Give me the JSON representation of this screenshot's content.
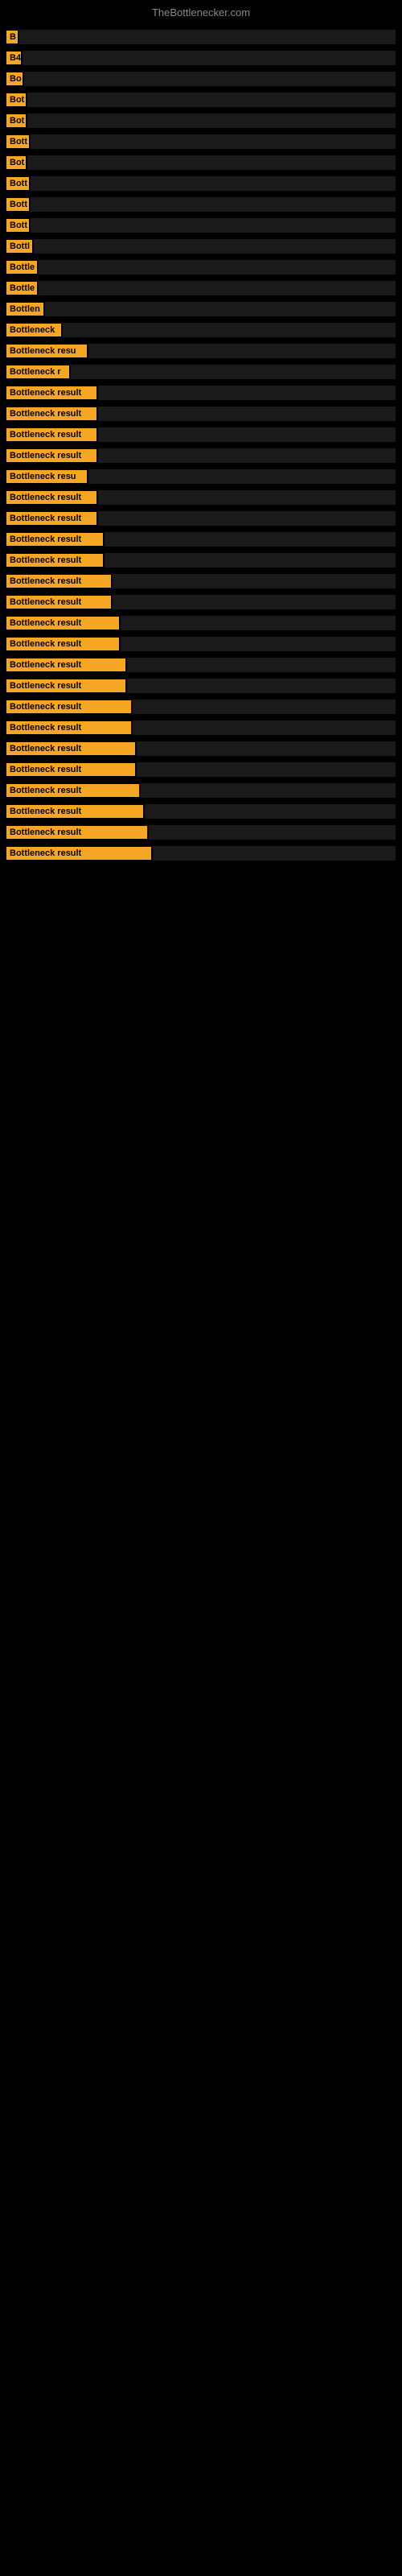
{
  "site": {
    "title": "TheBottlenecker.com"
  },
  "items": [
    {
      "label": "B",
      "labelWidth": 14,
      "barWidth": 380
    },
    {
      "label": "B4",
      "labelWidth": 18,
      "barWidth": 370
    },
    {
      "label": "Bo",
      "labelWidth": 20,
      "barWidth": 360
    },
    {
      "label": "Bot",
      "labelWidth": 24,
      "barWidth": 350
    },
    {
      "label": "Bot",
      "labelWidth": 24,
      "barWidth": 340
    },
    {
      "label": "Bott",
      "labelWidth": 28,
      "barWidth": 330
    },
    {
      "label": "Bot",
      "labelWidth": 24,
      "barWidth": 320
    },
    {
      "label": "Bott",
      "labelWidth": 28,
      "barWidth": 310
    },
    {
      "label": "Bott",
      "labelWidth": 28,
      "barWidth": 300
    },
    {
      "label": "Bott",
      "labelWidth": 28,
      "barWidth": 290
    },
    {
      "label": "Bottl",
      "labelWidth": 32,
      "barWidth": 280
    },
    {
      "label": "Bottle",
      "labelWidth": 38,
      "barWidth": 270
    },
    {
      "label": "Bottle",
      "labelWidth": 38,
      "barWidth": 260
    },
    {
      "label": "Bottlen",
      "labelWidth": 46,
      "barWidth": 250
    },
    {
      "label": "Bottleneck",
      "labelWidth": 68,
      "barWidth": 240
    },
    {
      "label": "Bottleneck resu",
      "labelWidth": 100,
      "barWidth": 210
    },
    {
      "label": "Bottleneck r",
      "labelWidth": 78,
      "barWidth": 220
    },
    {
      "label": "Bottleneck result",
      "labelWidth": 112,
      "barWidth": 200
    },
    {
      "label": "Bottleneck result",
      "labelWidth": 112,
      "barWidth": 190
    },
    {
      "label": "Bottleneck result",
      "labelWidth": 112,
      "barWidth": 185
    },
    {
      "label": "Bottleneck result",
      "labelWidth": 112,
      "barWidth": 180
    },
    {
      "label": "Bottleneck resu",
      "labelWidth": 100,
      "barWidth": 175
    },
    {
      "label": "Bottleneck result",
      "labelWidth": 112,
      "barWidth": 170
    },
    {
      "label": "Bottleneck result",
      "labelWidth": 112,
      "barWidth": 165
    },
    {
      "label": "Bottleneck result",
      "labelWidth": 120,
      "barWidth": 160
    },
    {
      "label": "Bottleneck result",
      "labelWidth": 120,
      "barWidth": 155
    },
    {
      "label": "Bottleneck result",
      "labelWidth": 130,
      "barWidth": 150
    },
    {
      "label": "Bottleneck result",
      "labelWidth": 130,
      "barWidth": 145
    },
    {
      "label": "Bottleneck result",
      "labelWidth": 140,
      "barWidth": 140
    },
    {
      "label": "Bottleneck result",
      "labelWidth": 140,
      "barWidth": 135
    },
    {
      "label": "Bottleneck result",
      "labelWidth": 148,
      "barWidth": 130
    },
    {
      "label": "Bottleneck result",
      "labelWidth": 148,
      "barWidth": 125
    },
    {
      "label": "Bottleneck result",
      "labelWidth": 155,
      "barWidth": 120
    },
    {
      "label": "Bottleneck result",
      "labelWidth": 155,
      "barWidth": 115
    },
    {
      "label": "Bottleneck result",
      "labelWidth": 160,
      "barWidth": 110
    },
    {
      "label": "Bottleneck result",
      "labelWidth": 160,
      "barWidth": 105
    },
    {
      "label": "Bottleneck result",
      "labelWidth": 165,
      "barWidth": 100
    },
    {
      "label": "Bottleneck result",
      "labelWidth": 170,
      "barWidth": 95
    },
    {
      "label": "Bottleneck result",
      "labelWidth": 175,
      "barWidth": 90
    },
    {
      "label": "Bottleneck result",
      "labelWidth": 180,
      "barWidth": 85
    }
  ]
}
